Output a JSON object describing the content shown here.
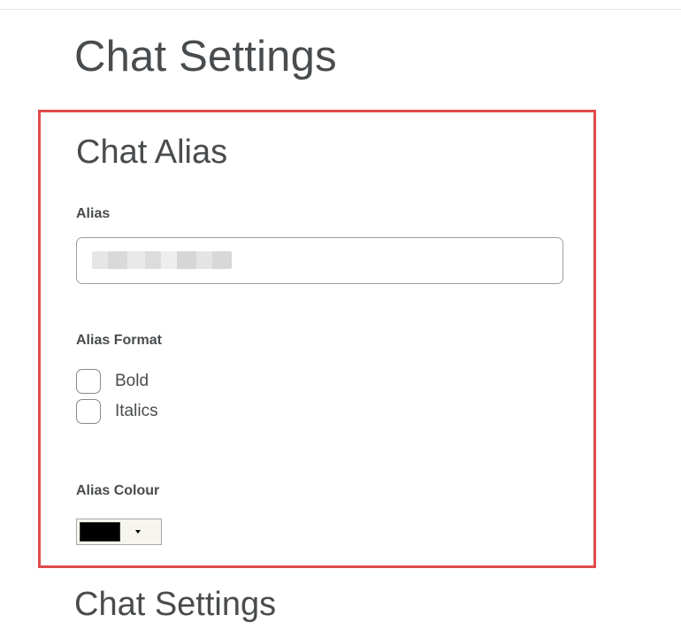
{
  "page": {
    "title": "Chat Settings"
  },
  "chat_alias": {
    "section_title": "Chat Alias",
    "alias_label": "Alias",
    "alias_value": "",
    "alias_format_label": "Alias Format",
    "format_options": [
      {
        "label": "Bold",
        "checked": false
      },
      {
        "label": "Italics",
        "checked": false
      }
    ],
    "alias_colour_label": "Alias Colour",
    "alias_colour_value": "#000000"
  },
  "chat_settings": {
    "section_title": "Chat Settings"
  },
  "colors": {
    "highlight_border": "#e04a4a",
    "text": "#494c4e"
  }
}
